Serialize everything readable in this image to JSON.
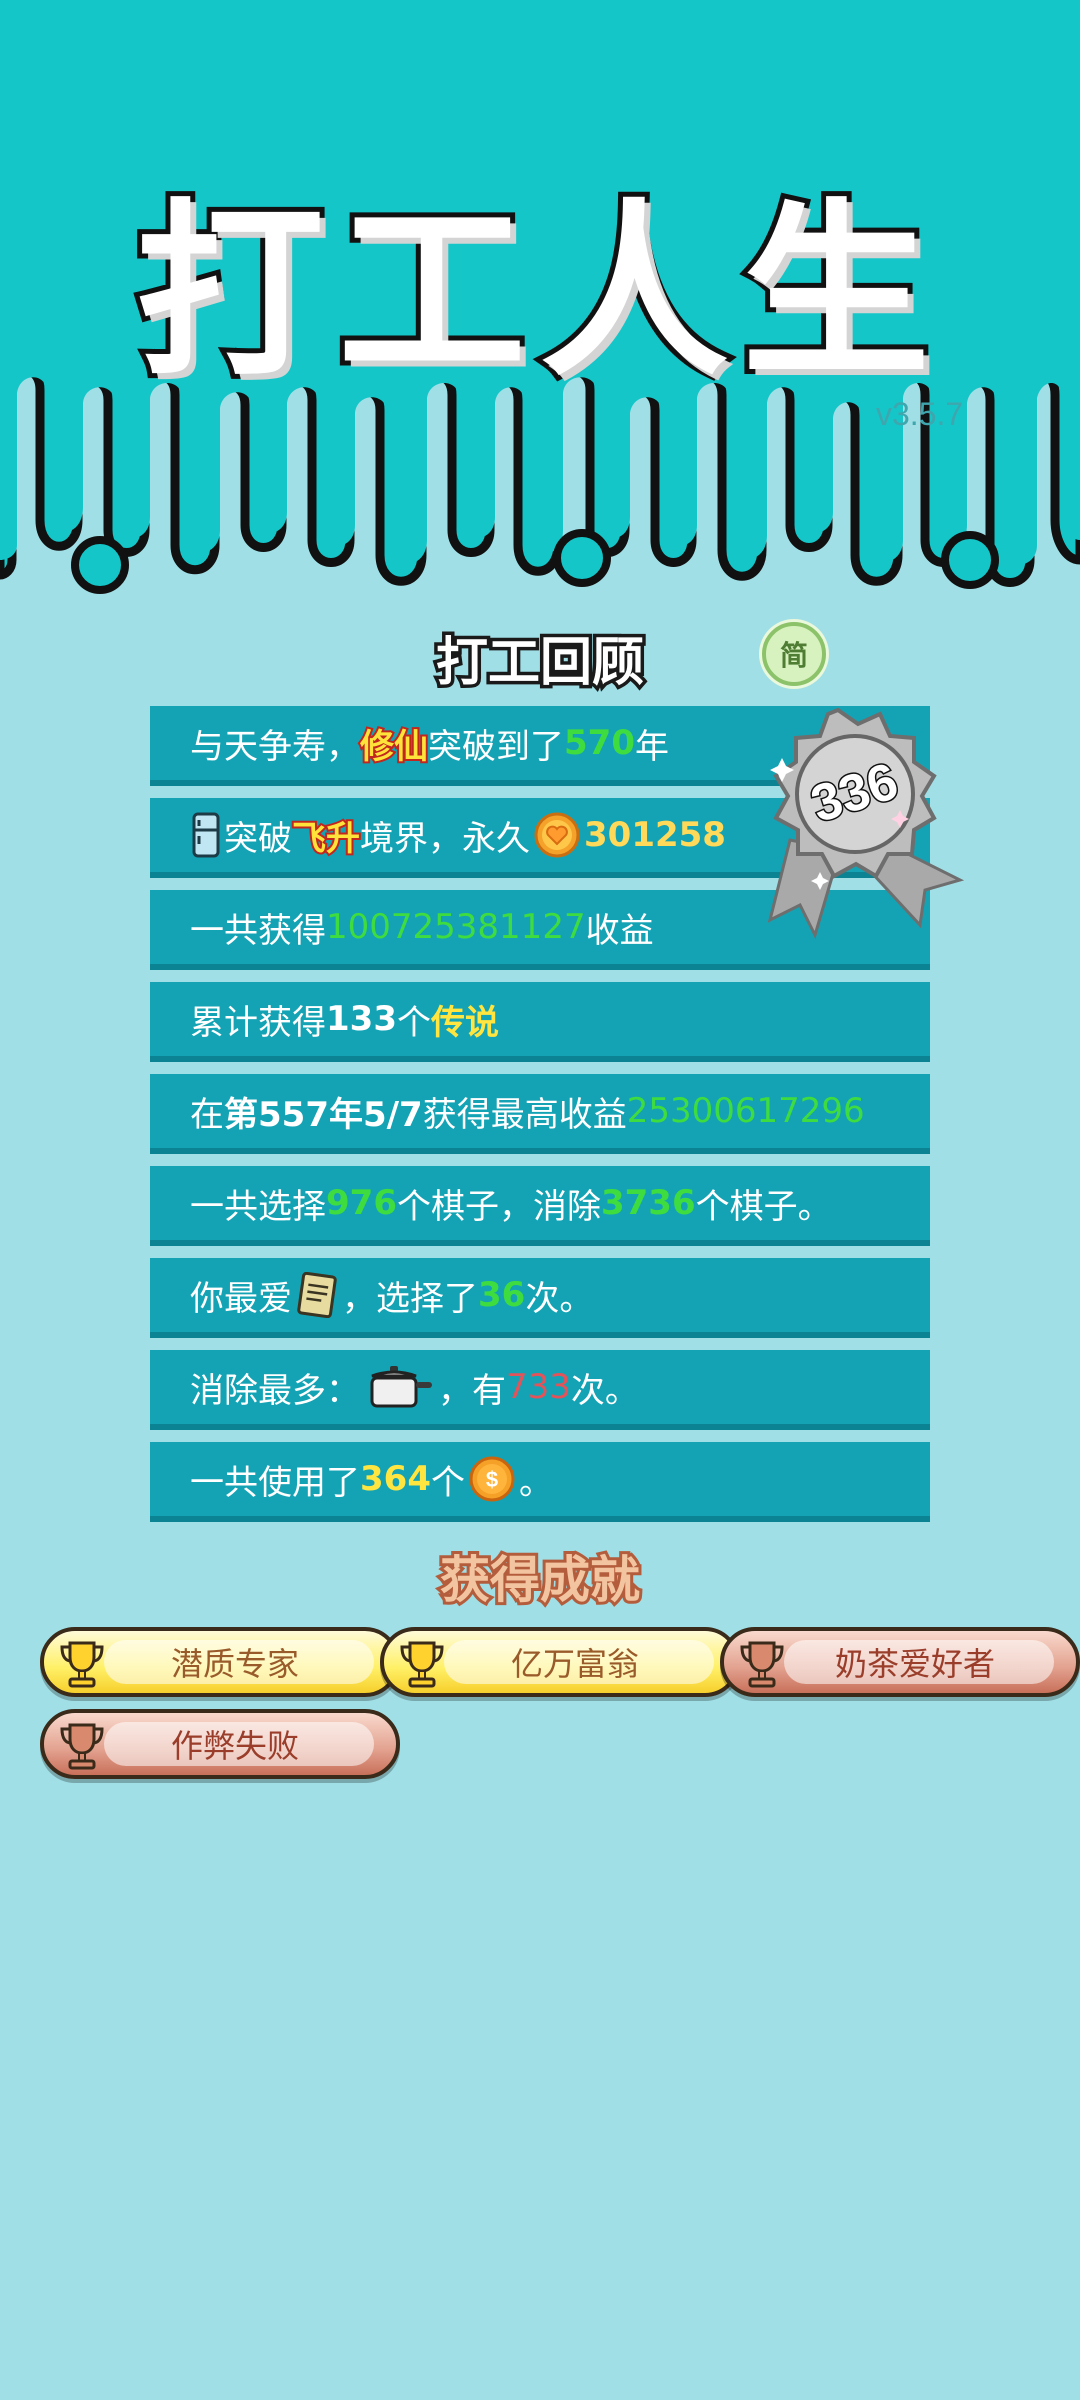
{
  "header": {
    "title": "打工人生",
    "version": "v3.5.7"
  },
  "review": {
    "title": "打工回顾",
    "lang_button": "简",
    "medal_value": "336",
    "rows": {
      "r1": {
        "a": "与天争寿，",
        "b": "修仙",
        "c": "突破到了",
        "d": "570",
        "e": "年"
      },
      "r2": {
        "a": "突破",
        "b": "飞升",
        "c": "境界，永久",
        "d": "301258"
      },
      "r3": {
        "a": "一共获得",
        "b": "100725381127",
        "c": "收益"
      },
      "r4": {
        "a": "累计获得",
        "b": "133",
        "c": "个",
        "d": "传说"
      },
      "r5": {
        "a": "在 ",
        "b": "第557年5/7",
        "c": " 获得最高收益",
        "d": "25300617296"
      },
      "r6": {
        "a": "一共选择",
        "b": "976",
        "c": "个棋子，消除",
        "d": "3736",
        "e": "个棋子。"
      },
      "r7": {
        "a": "你最爱",
        "b": "，选择了",
        "c": "36",
        "d": "次。"
      },
      "r8": {
        "a": "消除最多：",
        "b": "，有",
        "c": "733",
        "d": "次。"
      },
      "r9": {
        "a": "一共使用了",
        "b": "364",
        "c": "个",
        "d": "。"
      }
    }
  },
  "achievements": {
    "title": "获得成就",
    "items": [
      {
        "label": "潜质专家",
        "tier": "gold"
      },
      {
        "label": "亿万富翁",
        "tier": "gold"
      },
      {
        "label": "奶茶爱好者",
        "tier": "bronze"
      },
      {
        "label": "作弊失败",
        "tier": "bronze"
      }
    ]
  },
  "colors": {
    "header_bg": "#15c6c8",
    "page_bg": "#a0dfe6",
    "row_bg": "#14a3b4",
    "highlight_green": "#3fdc3f",
    "highlight_yellow": "#ffe540"
  },
  "icons": [
    "fridge-icon",
    "heart-coin-icon",
    "book-icon",
    "pot-icon",
    "dollar-coin-icon",
    "trophy-icon",
    "medal-icon"
  ]
}
